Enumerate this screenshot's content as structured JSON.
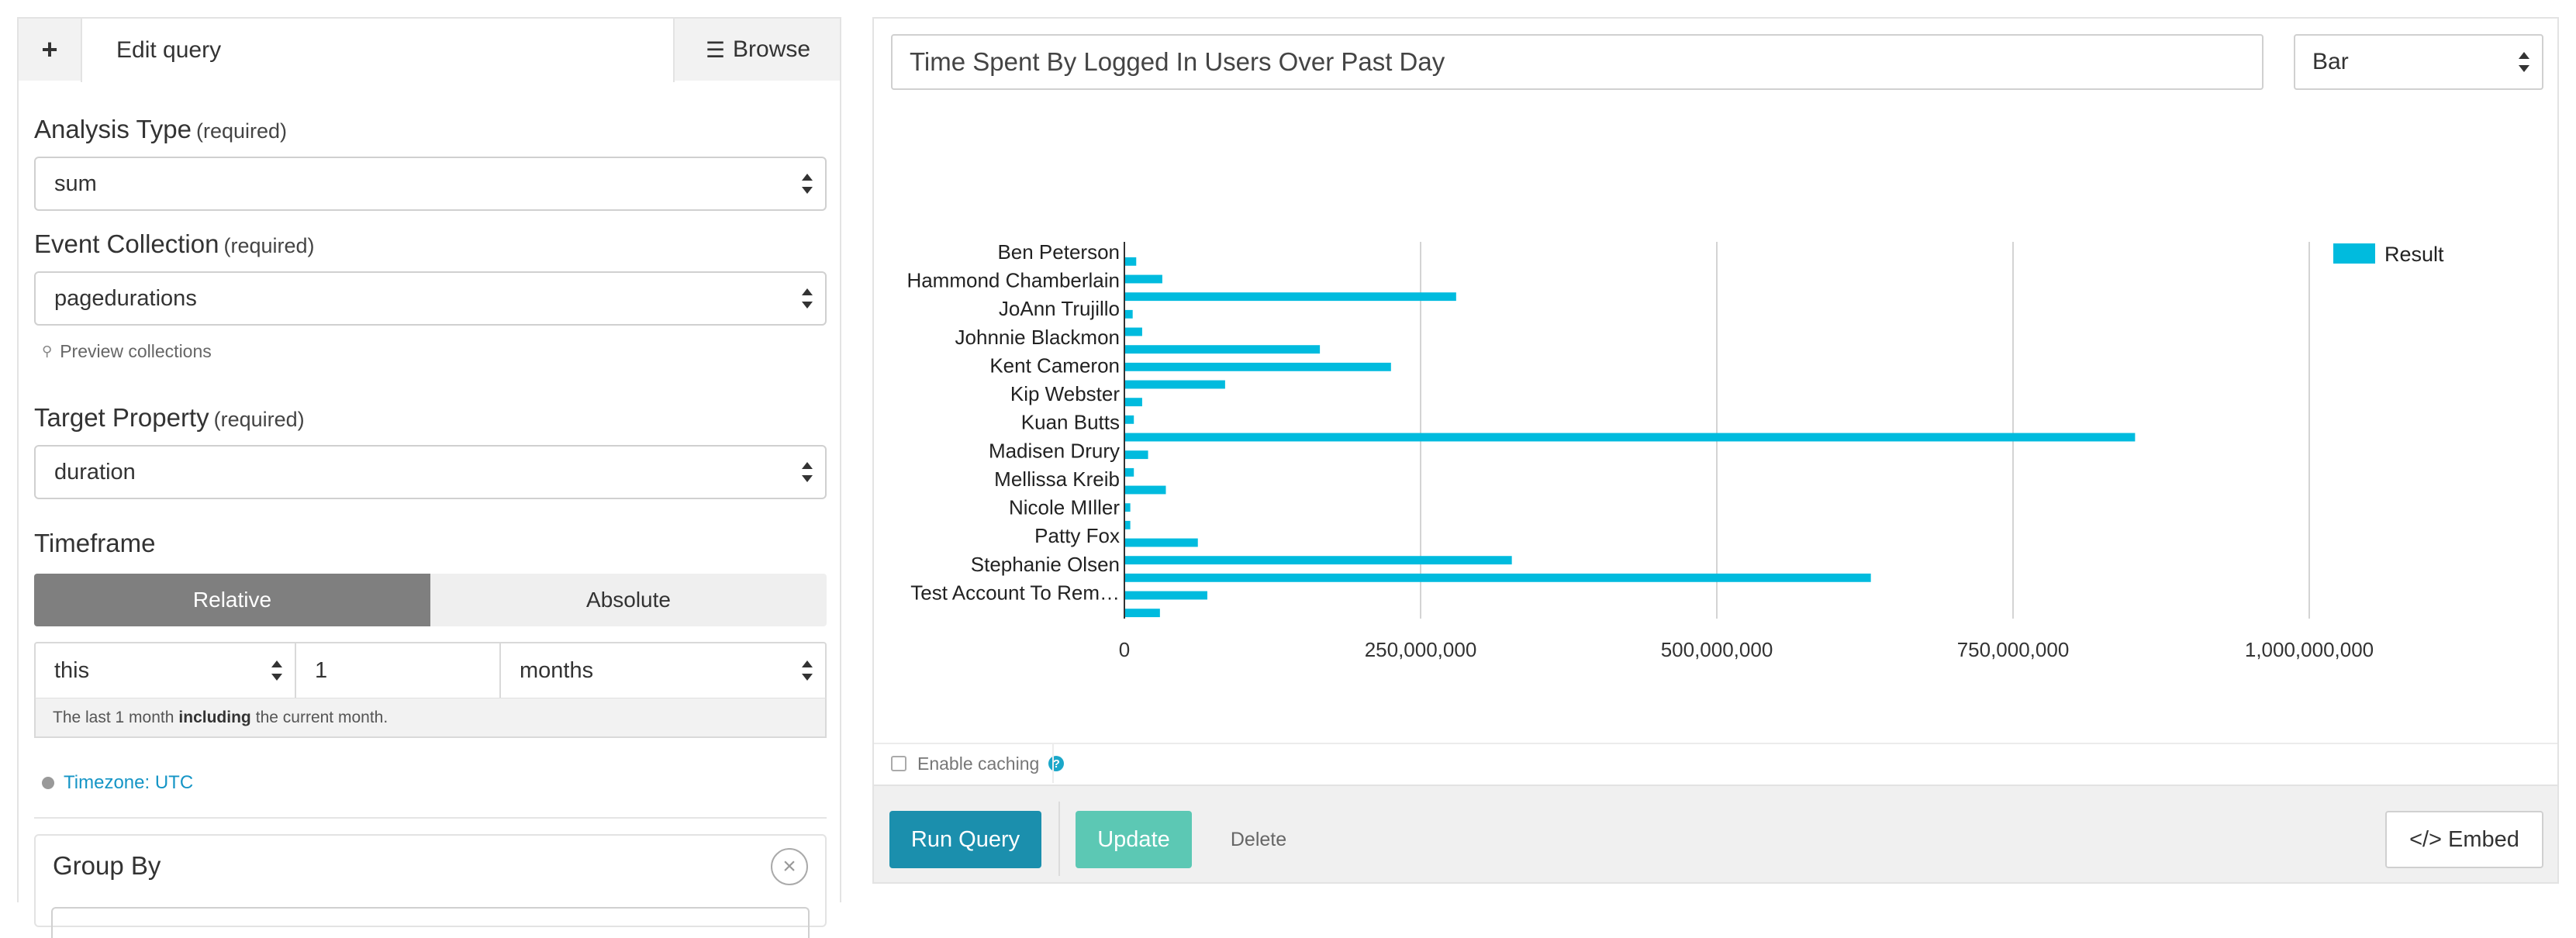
{
  "left": {
    "tabs": {
      "add": "+",
      "edit": "Edit query",
      "browse": "Browse"
    },
    "analysis_type": {
      "label": "Analysis Type",
      "required": "(required)",
      "value": "sum"
    },
    "event_collection": {
      "label": "Event Collection",
      "required": "(required)",
      "value": "pagedurations",
      "preview": "Preview collections"
    },
    "target_property": {
      "label": "Target Property",
      "required": "(required)",
      "value": "duration"
    },
    "timeframe": {
      "label": "Timeframe",
      "modes": [
        "Relative",
        "Absolute"
      ],
      "active_mode": "Relative",
      "relativity": "this",
      "amount": "1",
      "unit": "months",
      "help_prefix": "The last 1 month",
      "help_bold": "including",
      "help_suffix": "the current month."
    },
    "timezone": "Timezone: UTC",
    "group_by": {
      "label": "Group By"
    }
  },
  "right": {
    "title": "Time Spent By Logged In Users Over Past Day",
    "chart_type": "Bar",
    "enable_caching": "Enable caching",
    "buttons": {
      "run": "Run Query",
      "update": "Update",
      "delete": "Delete",
      "embed": "</> Embed"
    }
  },
  "colors": {
    "bar": "#00bbde",
    "run": "#1b8fad",
    "update": "#5cc8b4",
    "link": "#1595c6"
  },
  "chart_data": {
    "type": "bar",
    "orientation": "horizontal",
    "categories": [
      "Ben Peterson",
      "Hammond Chamberlain",
      "JoAnn Trujillo",
      "Johnnie Blackmon",
      "Kent Cameron",
      "Kip Webster",
      "Kuan Butts",
      "Madisen Drury",
      "Mellissa Kreib",
      "Nicole MIller",
      "Patty Fox",
      "Stephanie Olsen",
      "Test Account To Rem…"
    ],
    "series": [
      {
        "name": "Result",
        "values": [
          10000000,
          32000000,
          280000000,
          7000000,
          15000000,
          165000000,
          225000000,
          85000000,
          15000000,
          8000000,
          853000000,
          20000000,
          8000000,
          35000000,
          5000000,
          5000000,
          62000000,
          327000000,
          630000000,
          70000000,
          30000000
        ]
      }
    ],
    "xticks": [
      "0",
      "250,000,000",
      "500,000,000",
      "750,000,000",
      "1,000,000,000"
    ],
    "xlim": [
      0,
      1000000000
    ],
    "grid": true,
    "legend": "top-right"
  }
}
